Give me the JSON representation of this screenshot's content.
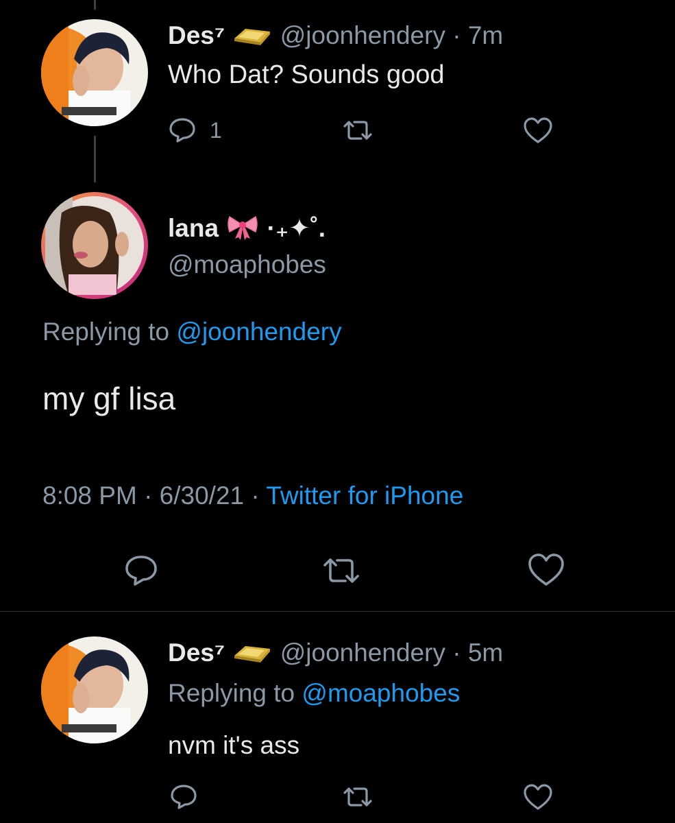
{
  "tweet1": {
    "display_name": "Des⁷",
    "handle": "@joonhendery",
    "separator": "·",
    "time": "7m",
    "text": "Who Dat? Sounds good",
    "reply_count": "1"
  },
  "tweet2": {
    "display_name": "lana",
    "name_decoration": "·₊✦˚.",
    "handle": "@moaphobes",
    "replying_prefix": "Replying to",
    "replying_handle": "@joonhendery",
    "text": "my gf lisa",
    "timestamp": "8:08 PM · 6/30/21 ·",
    "source": "Twitter for iPhone"
  },
  "tweet3": {
    "display_name": "Des⁷",
    "handle": "@joonhendery",
    "separator": "·",
    "time": "5m",
    "replying_prefix": "Replying to",
    "replying_handle": "@moaphobes",
    "text": "nvm it's ass"
  },
  "icons": {
    "reply": "reply-icon",
    "retweet": "retweet-icon",
    "like": "heart-icon",
    "gold_bar": "gold-bar-emoji",
    "ribbon": "ribbon-emoji"
  },
  "colors": {
    "background": "#000000",
    "text": "#e7e9ea",
    "muted": "#8b98a5",
    "link": "#1d9bf0"
  }
}
